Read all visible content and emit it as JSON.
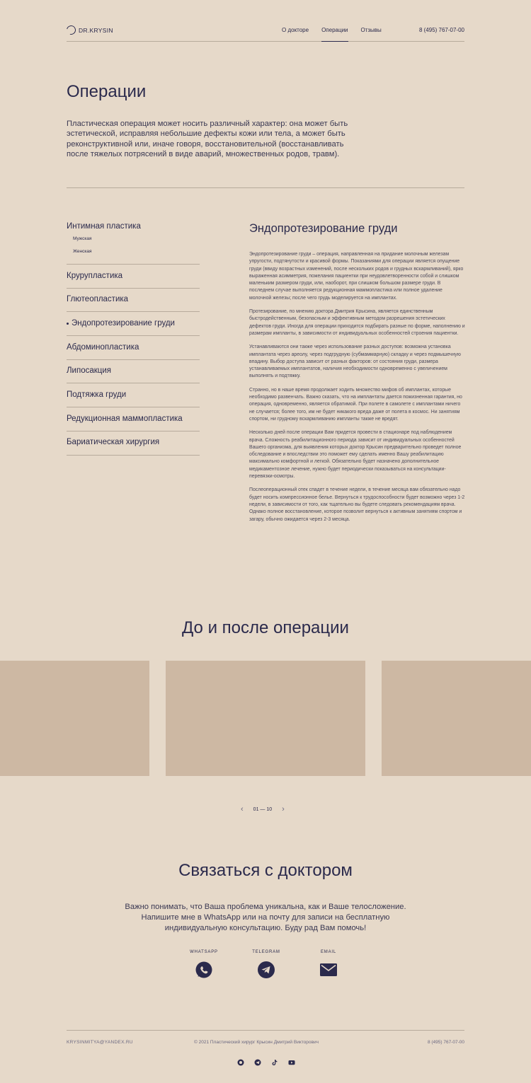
{
  "header": {
    "logo_text": "DR.KRYSIN",
    "nav": [
      {
        "label": "О докторе",
        "active": false
      },
      {
        "label": "Операции",
        "active": true
      },
      {
        "label": "Отзывы",
        "active": false
      }
    ],
    "phone": "8 (495) 767-07-00"
  },
  "page": {
    "title": "Операции",
    "intro": "Пластическая операция может носить различный характер: она может быть эстетической, исправляя небольшие дефекты кожи или тела, а может быть реконструктивной или, иначе говоря, восстановительной (восстанавливать после тяжелых потрясений в виде аварий, множественных родов, травм)."
  },
  "sidebar": {
    "intimate": "Интимная пластика",
    "intimate_sub": [
      "Мужская",
      "Женская"
    ],
    "items": [
      {
        "label": "Крурупластика",
        "active": false
      },
      {
        "label": "Глютеопластика",
        "active": false
      },
      {
        "label": "Эндопротезирование груди",
        "active": true
      },
      {
        "label": "Абдоминопластика",
        "active": false
      },
      {
        "label": "Липосакция",
        "active": false
      },
      {
        "label": "Подтяжка груди",
        "active": false
      },
      {
        "label": "Редукционная маммопластика",
        "active": false
      },
      {
        "label": "Бариатическая хирургия",
        "active": false
      }
    ]
  },
  "article": {
    "title": "Эндопротезирование груди",
    "paragraphs": [
      "Эндопротезирование груди – операция, направленная на придание молочным железам упругости, подтянутости и красивой формы. Показаниями для операции является опущение груди (ввиду возрастных изменений, после нескольких родов и грудных вскармливаний), ярко выраженная асимметрия, пожелания пациентки при неудовлетворенности собой и слишком маленьким размером груди, или, наоборот,  при слишком большом размере груди. В последнем случае выполняется редукционная маммопластика или полное удаление молочной железы; после чего грудь моделируется на имплантах.",
      "Протезирование, по мнению доктора Дмитрия Крысина, является единственным быстродейственным, безопасным и эффективным методом разрешения эстетических дефектов груди. Иногда для операции приходится подбирать разные по форме, наполнению и размерам импланты, в зависимости от индивидуальных особенностей строения пациентки.",
      "Устанавливаются они также через использование разных доступов: возможна установка имплантата через ареолу, через подгрудную (субмаммарную) складку и через подмышечную впадину. Выбор доступа зависит от разных факторов: от состояния груди, размера устанавливаемых имплантатов, наличия необходимости одновременно с увеличением выполнять и подтяжку.",
      "Странно, но в наше время продолжает ходить множество мифов об имплантах, которые необходимо развенчать. Важно сказать, что на имплантаты дается пожизненная гарантия, но операция, одновременно, является обратимой. При полете в самолете с имплантами ничего не случается; более того, им не будет никакого вреда даже от полета в космос. Ни занятиям спортом, ни грудному вскармливанию импланты также не вредят.",
      "Несколько дней после операции Вам придется провести в стационаре под наблюдением врача. Сложность реабилитационного периода зависит от индивидуальных особенностей Вашего организма, для выявления которых доктор Крысин предварительно проведет полное обследование и впоследствии это поможет ему сделать именно Вашу реабилитацию максимально комфортной и легкой. Обязательно будет назначено дополнительное медикаментозное лечение, нужно будет периодически показываться на консультации-перевязки-осмотры.",
      "Послеоперационный отек спадет в течение недели, в течение месяца вам обязательно надо будет носить компрессионное белье. Вернуться к трудоспособности будет возможно через 1-2 недели, в зависимости от того, как тщательно вы будете следовать рекомендациям врача. Однако полное восстановление, которое позволит вернуться к активным занятиям спортом и загару, обычно ожидается через 2-3 месяца."
    ]
  },
  "gallery": {
    "title": "До и после операции",
    "pager": "01 — 10"
  },
  "contact": {
    "title": "Связаться с доктором",
    "text": "Важно понимать, что Ваша проблема уникальна, как и Ваше телосложение. Напишите мне в WhatsApp или на почту для записи на бесплатную индивидуальную консультацию. Буду рад Вам помочь!",
    "whatsapp": "WHATSAPP",
    "telegram": "TELEGRAM",
    "email": "EMAIL"
  },
  "footer": {
    "email": "KRYSINMITYA@YANDEX.RU",
    "copyright": "© 2021 Пластический хирург Крысин Дмитрий Викторович",
    "phone": "8 (495) 767-07-00"
  },
  "colors": {
    "background": "#e6d9c9",
    "text": "#2b2a4c",
    "divider": "#b7ab9c"
  }
}
